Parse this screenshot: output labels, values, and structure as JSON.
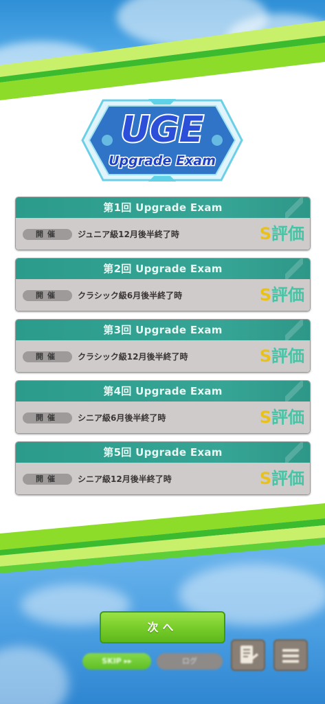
{
  "logo": {
    "title": "UGE",
    "subtitle": "Upgrade Exam"
  },
  "exams": [
    {
      "heading": "第1回 Upgrade Exam",
      "badge": "開催",
      "date": "ジュニア級12月後半終了時",
      "grade_letter": "S",
      "grade_text": "評価"
    },
    {
      "heading": "第2回 Upgrade Exam",
      "badge": "開催",
      "date": "クラシック級6月後半終了時",
      "grade_letter": "S",
      "grade_text": "評価"
    },
    {
      "heading": "第3回 Upgrade Exam",
      "badge": "開催",
      "date": "クラシック級12月後半終了時",
      "grade_letter": "S",
      "grade_text": "評価"
    },
    {
      "heading": "第4回 Upgrade Exam",
      "badge": "開催",
      "date": "シニア級6月後半終了時",
      "grade_letter": "S",
      "grade_text": "評価"
    },
    {
      "heading": "第5回 Upgrade Exam",
      "badge": "開催",
      "date": "シニア級12月後半終了時",
      "grade_letter": "S",
      "grade_text": "評価"
    }
  ],
  "footer": {
    "next_label": "次へ",
    "skip_label": "SKIP ▸▸",
    "log_label": "ログ",
    "journal_icon": "journal-icon",
    "menu_icon": "menu-icon"
  },
  "colors": {
    "accent_green": "#78cd2b",
    "header_teal": "#2b9b8b",
    "card_body": "#cfcbcb",
    "grade_gold": "#e8c21a",
    "grade_teal": "#47c4a5"
  }
}
